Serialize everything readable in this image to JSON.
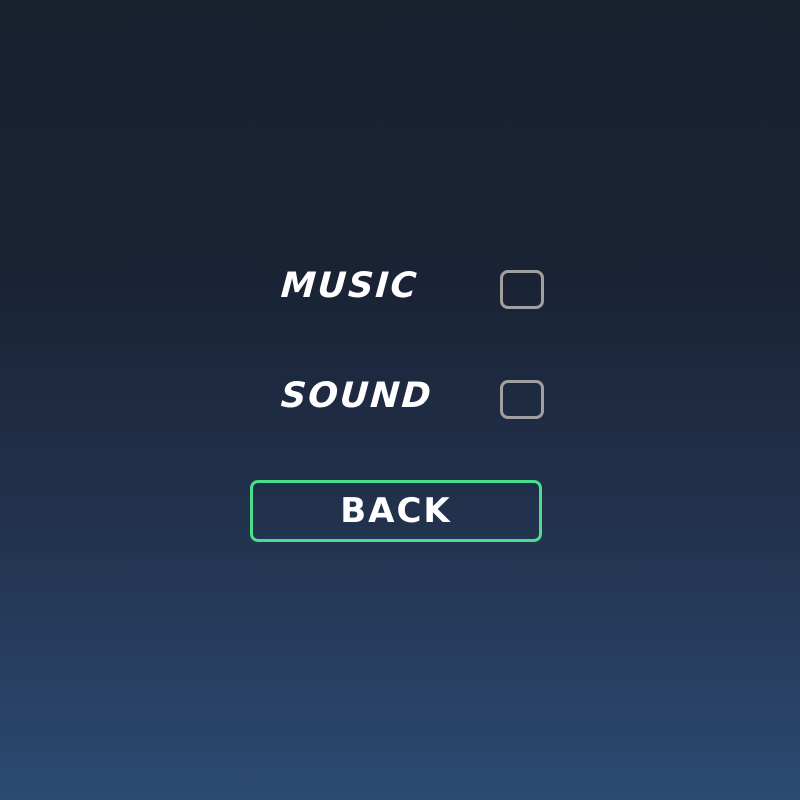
{
  "settings": {
    "music": {
      "label": "MUSIC",
      "checked": false
    },
    "sound": {
      "label": "SOUND",
      "checked": false
    }
  },
  "back_button": {
    "label": "BACK"
  },
  "colors": {
    "accent": "#4ade8c",
    "checkbox_border": "#a0a0a0",
    "text": "#ffffff"
  }
}
